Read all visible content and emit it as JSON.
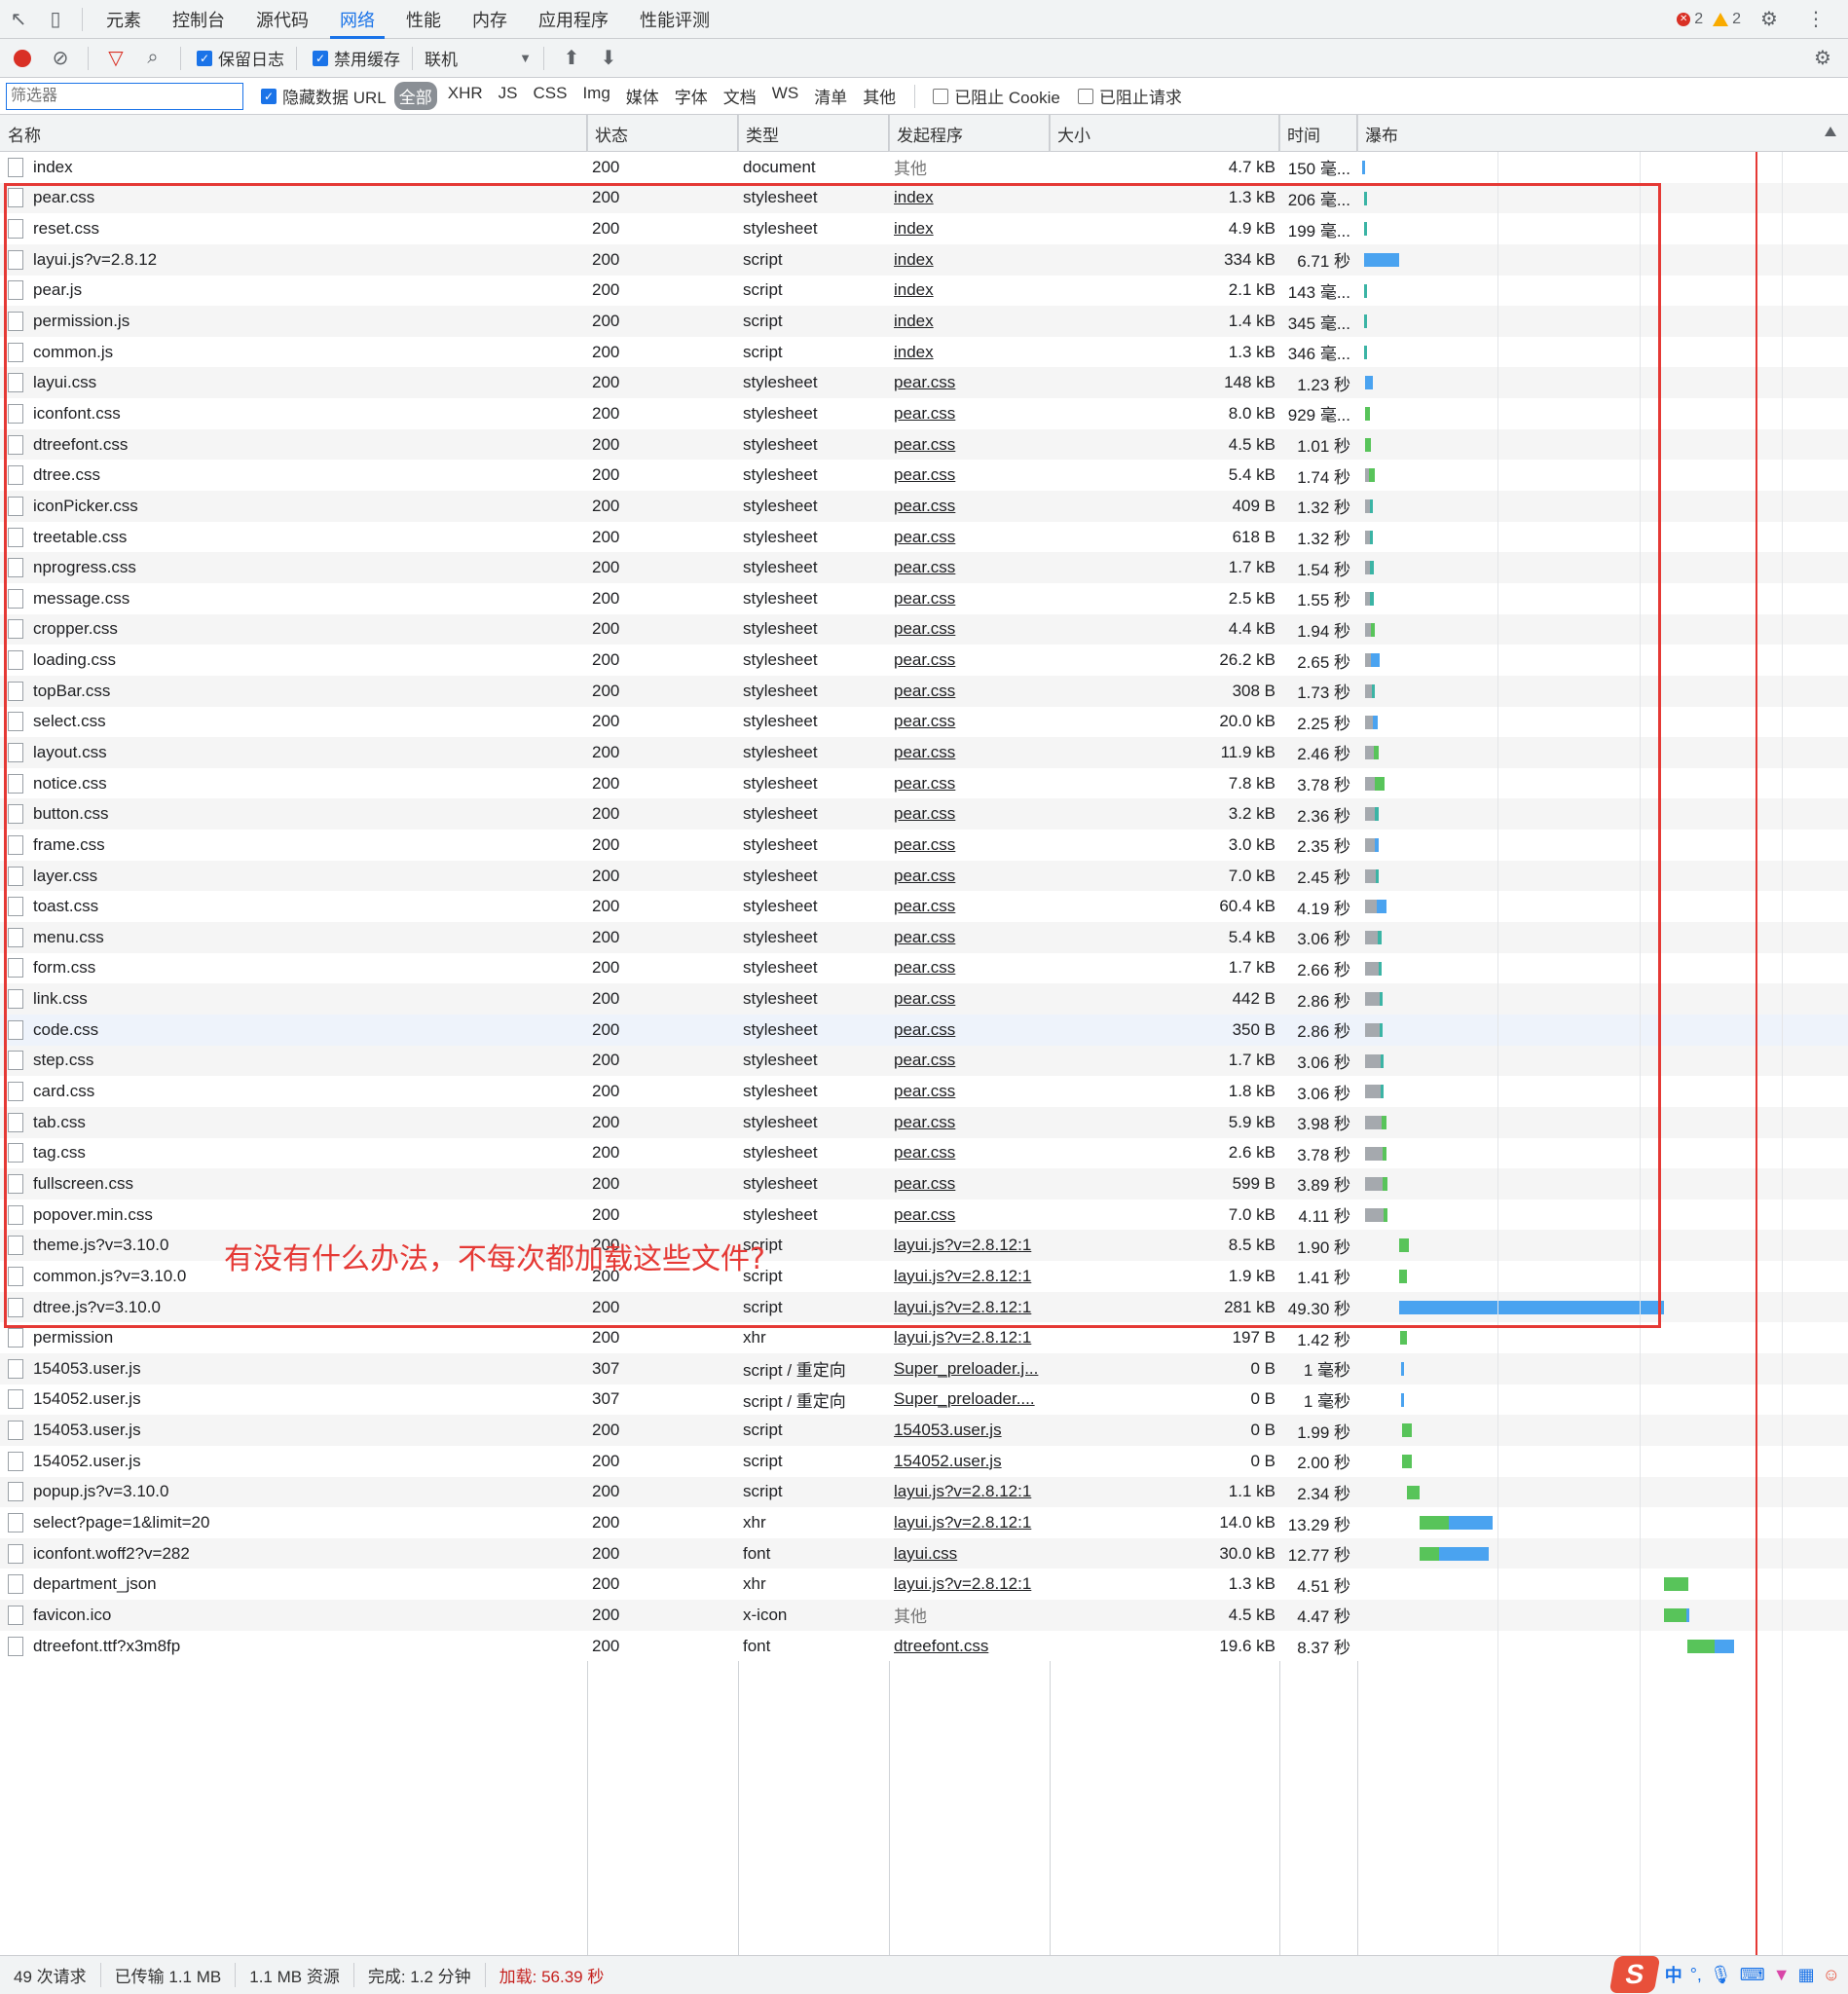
{
  "tabs": [
    "元素",
    "控制台",
    "源代码",
    "网络",
    "性能",
    "内存",
    "应用程序",
    "性能评测"
  ],
  "active_tab": 3,
  "issues": {
    "errors": "2",
    "warnings": "2"
  },
  "toolbar": {
    "preserve_log": "保留日志",
    "disable_cache": "禁用缓存",
    "throttle": "联机"
  },
  "filterbar": {
    "placeholder": "筛选器",
    "hide_data_url": "隐藏数据 URL",
    "types": [
      "全部",
      "XHR",
      "JS",
      "CSS",
      "Img",
      "媒体",
      "字体",
      "文档",
      "WS",
      "清单",
      "其他"
    ],
    "blocked_cookies": "已阻止 Cookie",
    "blocked_requests": "已阻止请求"
  },
  "columns": {
    "name": "名称",
    "status": "状态",
    "type": "类型",
    "initiator": "发起程序",
    "size": "大小",
    "time": "时间",
    "waterfall": "瀑布"
  },
  "colors": {
    "blue": "#4aa3f0",
    "green": "#58c45a",
    "gray": "#a5a9ae",
    "teal": "#3bb4a5",
    "red": "#e53935"
  },
  "rows": [
    {
      "name": "index",
      "status": "200",
      "type": "document",
      "initiator": "其他",
      "init_link": false,
      "size": "4.7 kB",
      "time": "150 毫...",
      "bars": [
        [
          0.008,
          0.004,
          "blue"
        ]
      ]
    },
    {
      "name": "pear.css",
      "status": "200",
      "type": "stylesheet",
      "initiator": "index",
      "init_link": true,
      "size": "1.3 kB",
      "time": "206 毫...",
      "bars": [
        [
          0.012,
          0.004,
          "teal"
        ]
      ]
    },
    {
      "name": "reset.css",
      "status": "200",
      "type": "stylesheet",
      "initiator": "index",
      "init_link": true,
      "size": "4.9 kB",
      "time": "199 毫...",
      "bars": [
        [
          0.012,
          0.004,
          "teal"
        ]
      ]
    },
    {
      "name": "layui.js?v=2.8.12",
      "status": "200",
      "type": "script",
      "initiator": "index",
      "init_link": true,
      "size": "334 kB",
      "time": "6.71 秒",
      "bars": [
        [
          0.012,
          0.072,
          "blue"
        ]
      ]
    },
    {
      "name": "pear.js",
      "status": "200",
      "type": "script",
      "initiator": "index",
      "init_link": true,
      "size": "2.1 kB",
      "time": "143 毫...",
      "bars": [
        [
          0.012,
          0.004,
          "teal"
        ]
      ]
    },
    {
      "name": "permission.js",
      "status": "200",
      "type": "script",
      "initiator": "index",
      "init_link": true,
      "size": "1.4 kB",
      "time": "345 毫...",
      "bars": [
        [
          0.012,
          0.004,
          "teal"
        ]
      ]
    },
    {
      "name": "common.js",
      "status": "200",
      "type": "script",
      "initiator": "index",
      "init_link": true,
      "size": "1.3 kB",
      "time": "346 毫...",
      "bars": [
        [
          0.012,
          0.004,
          "teal"
        ]
      ]
    },
    {
      "name": "layui.css",
      "status": "200",
      "type": "stylesheet",
      "initiator": "pear.css",
      "init_link": true,
      "size": "148 kB",
      "time": "1.23 秒",
      "bars": [
        [
          0.014,
          0.016,
          "blue"
        ]
      ]
    },
    {
      "name": "iconfont.css",
      "status": "200",
      "type": "stylesheet",
      "initiator": "pear.css",
      "init_link": true,
      "size": "8.0 kB",
      "time": "929 毫...",
      "bars": [
        [
          0.014,
          0.01,
          "green"
        ]
      ]
    },
    {
      "name": "dtreefont.css",
      "status": "200",
      "type": "stylesheet",
      "initiator": "pear.css",
      "init_link": true,
      "size": "4.5 kB",
      "time": "1.01 秒",
      "bars": [
        [
          0.014,
          0.012,
          "green"
        ]
      ]
    },
    {
      "name": "dtree.css",
      "status": "200",
      "type": "stylesheet",
      "initiator": "pear.css",
      "init_link": true,
      "size": "5.4 kB",
      "time": "1.74 秒",
      "bars": [
        [
          0.014,
          0.008,
          "gray"
        ],
        [
          0.022,
          0.012,
          "green"
        ]
      ]
    },
    {
      "name": "iconPicker.css",
      "status": "200",
      "type": "stylesheet",
      "initiator": "pear.css",
      "init_link": true,
      "size": "409 B",
      "time": "1.32 秒",
      "bars": [
        [
          0.014,
          0.01,
          "gray"
        ],
        [
          0.024,
          0.006,
          "teal"
        ]
      ]
    },
    {
      "name": "treetable.css",
      "status": "200",
      "type": "stylesheet",
      "initiator": "pear.css",
      "init_link": true,
      "size": "618 B",
      "time": "1.32 秒",
      "bars": [
        [
          0.014,
          0.01,
          "gray"
        ],
        [
          0.024,
          0.006,
          "teal"
        ]
      ]
    },
    {
      "name": "nprogress.css",
      "status": "200",
      "type": "stylesheet",
      "initiator": "pear.css",
      "init_link": true,
      "size": "1.7 kB",
      "time": "1.54 秒",
      "bars": [
        [
          0.014,
          0.01,
          "gray"
        ],
        [
          0.024,
          0.008,
          "teal"
        ]
      ]
    },
    {
      "name": "message.css",
      "status": "200",
      "type": "stylesheet",
      "initiator": "pear.css",
      "init_link": true,
      "size": "2.5 kB",
      "time": "1.55 秒",
      "bars": [
        [
          0.014,
          0.01,
          "gray"
        ],
        [
          0.024,
          0.008,
          "teal"
        ]
      ]
    },
    {
      "name": "cropper.css",
      "status": "200",
      "type": "stylesheet",
      "initiator": "pear.css",
      "init_link": true,
      "size": "4.4 kB",
      "time": "1.94 秒",
      "bars": [
        [
          0.014,
          0.012,
          "gray"
        ],
        [
          0.026,
          0.008,
          "green"
        ]
      ]
    },
    {
      "name": "loading.css",
      "status": "200",
      "type": "stylesheet",
      "initiator": "pear.css",
      "init_link": true,
      "size": "26.2 kB",
      "time": "2.65 秒",
      "bars": [
        [
          0.014,
          0.012,
          "gray"
        ],
        [
          0.026,
          0.018,
          "blue"
        ]
      ]
    },
    {
      "name": "topBar.css",
      "status": "200",
      "type": "stylesheet",
      "initiator": "pear.css",
      "init_link": true,
      "size": "308 B",
      "time": "1.73 秒",
      "bars": [
        [
          0.014,
          0.014,
          "gray"
        ],
        [
          0.028,
          0.006,
          "teal"
        ]
      ]
    },
    {
      "name": "select.css",
      "status": "200",
      "type": "stylesheet",
      "initiator": "pear.css",
      "init_link": true,
      "size": "20.0 kB",
      "time": "2.25 秒",
      "bars": [
        [
          0.014,
          0.016,
          "gray"
        ],
        [
          0.03,
          0.01,
          "blue"
        ]
      ]
    },
    {
      "name": "layout.css",
      "status": "200",
      "type": "stylesheet",
      "initiator": "pear.css",
      "init_link": true,
      "size": "11.9 kB",
      "time": "2.46 秒",
      "bars": [
        [
          0.014,
          0.018,
          "gray"
        ],
        [
          0.032,
          0.01,
          "green"
        ]
      ]
    },
    {
      "name": "notice.css",
      "status": "200",
      "type": "stylesheet",
      "initiator": "pear.css",
      "init_link": true,
      "size": "7.8 kB",
      "time": "3.78 秒",
      "bars": [
        [
          0.014,
          0.02,
          "gray"
        ],
        [
          0.034,
          0.02,
          "green"
        ]
      ]
    },
    {
      "name": "button.css",
      "status": "200",
      "type": "stylesheet",
      "initiator": "pear.css",
      "init_link": true,
      "size": "3.2 kB",
      "time": "2.36 秒",
      "bars": [
        [
          0.014,
          0.02,
          "gray"
        ],
        [
          0.034,
          0.008,
          "teal"
        ]
      ]
    },
    {
      "name": "frame.css",
      "status": "200",
      "type": "stylesheet",
      "initiator": "pear.css",
      "init_link": true,
      "size": "3.0 kB",
      "time": "2.35 秒",
      "bars": [
        [
          0.014,
          0.02,
          "gray"
        ],
        [
          0.034,
          0.008,
          "blue"
        ]
      ]
    },
    {
      "name": "layer.css",
      "status": "200",
      "type": "stylesheet",
      "initiator": "pear.css",
      "init_link": true,
      "size": "7.0 kB",
      "time": "2.45 秒",
      "bars": [
        [
          0.014,
          0.022,
          "gray"
        ],
        [
          0.036,
          0.006,
          "teal"
        ]
      ]
    },
    {
      "name": "toast.css",
      "status": "200",
      "type": "stylesheet",
      "initiator": "pear.css",
      "init_link": true,
      "size": "60.4 kB",
      "time": "4.19 秒",
      "bars": [
        [
          0.014,
          0.024,
          "gray"
        ],
        [
          0.038,
          0.02,
          "blue"
        ]
      ]
    },
    {
      "name": "menu.css",
      "status": "200",
      "type": "stylesheet",
      "initiator": "pear.css",
      "init_link": true,
      "size": "5.4 kB",
      "time": "3.06 秒",
      "bars": [
        [
          0.014,
          0.026,
          "gray"
        ],
        [
          0.04,
          0.008,
          "teal"
        ]
      ]
    },
    {
      "name": "form.css",
      "status": "200",
      "type": "stylesheet",
      "initiator": "pear.css",
      "init_link": true,
      "size": "1.7 kB",
      "time": "2.66 秒",
      "bars": [
        [
          0.014,
          0.028,
          "gray"
        ],
        [
          0.042,
          0.006,
          "teal"
        ]
      ]
    },
    {
      "name": "link.css",
      "status": "200",
      "type": "stylesheet",
      "initiator": "pear.css",
      "init_link": true,
      "size": "442 B",
      "time": "2.86 秒",
      "bars": [
        [
          0.014,
          0.03,
          "gray"
        ],
        [
          0.044,
          0.006,
          "teal"
        ]
      ]
    },
    {
      "name": "code.css",
      "status": "200",
      "type": "stylesheet",
      "initiator": "pear.css",
      "init_link": true,
      "size": "350 B",
      "time": "2.86 秒",
      "bars": [
        [
          0.014,
          0.03,
          "gray"
        ],
        [
          0.044,
          0.006,
          "teal"
        ]
      ],
      "hl": true
    },
    {
      "name": "step.css",
      "status": "200",
      "type": "stylesheet",
      "initiator": "pear.css",
      "init_link": true,
      "size": "1.7 kB",
      "time": "3.06 秒",
      "bars": [
        [
          0.014,
          0.032,
          "gray"
        ],
        [
          0.046,
          0.006,
          "teal"
        ]
      ]
    },
    {
      "name": "card.css",
      "status": "200",
      "type": "stylesheet",
      "initiator": "pear.css",
      "init_link": true,
      "size": "1.8 kB",
      "time": "3.06 秒",
      "bars": [
        [
          0.014,
          0.032,
          "gray"
        ],
        [
          0.046,
          0.006,
          "teal"
        ]
      ]
    },
    {
      "name": "tab.css",
      "status": "200",
      "type": "stylesheet",
      "initiator": "pear.css",
      "init_link": true,
      "size": "5.9 kB",
      "time": "3.98 秒",
      "bars": [
        [
          0.014,
          0.034,
          "gray"
        ],
        [
          0.048,
          0.01,
          "green"
        ]
      ]
    },
    {
      "name": "tag.css",
      "status": "200",
      "type": "stylesheet",
      "initiator": "pear.css",
      "init_link": true,
      "size": "2.6 kB",
      "time": "3.78 秒",
      "bars": [
        [
          0.014,
          0.036,
          "gray"
        ],
        [
          0.05,
          0.008,
          "green"
        ]
      ]
    },
    {
      "name": "fullscreen.css",
      "status": "200",
      "type": "stylesheet",
      "initiator": "pear.css",
      "init_link": true,
      "size": "599 B",
      "time": "3.89 秒",
      "bars": [
        [
          0.014,
          0.036,
          "gray"
        ],
        [
          0.05,
          0.01,
          "green"
        ]
      ]
    },
    {
      "name": "popover.min.css",
      "status": "200",
      "type": "stylesheet",
      "initiator": "pear.css",
      "init_link": true,
      "size": "7.0 kB",
      "time": "4.11 秒",
      "bars": [
        [
          0.014,
          0.038,
          "gray"
        ],
        [
          0.052,
          0.008,
          "green"
        ]
      ]
    },
    {
      "name": "theme.js?v=3.10.0",
      "status": "200",
      "type": "script",
      "initiator": "layui.js?v=2.8.12:1",
      "init_link": true,
      "size": "8.5 kB",
      "time": "1.90 秒",
      "bars": [
        [
          0.084,
          0.02,
          "green"
        ]
      ]
    },
    {
      "name": "common.js?v=3.10.0",
      "status": "200",
      "type": "script",
      "initiator": "layui.js?v=2.8.12:1",
      "init_link": true,
      "size": "1.9 kB",
      "time": "1.41 秒",
      "bars": [
        [
          0.084,
          0.016,
          "green"
        ]
      ]
    },
    {
      "name": "dtree.js?v=3.10.0",
      "status": "200",
      "type": "script",
      "initiator": "layui.js?v=2.8.12:1",
      "init_link": true,
      "size": "281 kB",
      "time": "49.30 秒",
      "bars": [
        [
          0.084,
          0.54,
          "blue"
        ]
      ]
    },
    {
      "name": "permission",
      "status": "200",
      "type": "xhr",
      "initiator": "layui.js?v=2.8.12:1",
      "init_link": true,
      "size": "197 B",
      "time": "1.42 秒",
      "bars": [
        [
          0.086,
          0.014,
          "green"
        ]
      ]
    },
    {
      "name": "154053.user.js",
      "status": "307",
      "type": "script / 重定向",
      "initiator": "Super_preloader.j...",
      "init_link": true,
      "size": "0 B",
      "time": "1 毫秒",
      "bars": [
        [
          0.088,
          0.004,
          "blue"
        ]
      ]
    },
    {
      "name": "154052.user.js",
      "status": "307",
      "type": "script / 重定向",
      "initiator": "Super_preloader....",
      "init_link": true,
      "size": "0 B",
      "time": "1 毫秒",
      "bars": [
        [
          0.088,
          0.004,
          "blue"
        ]
      ]
    },
    {
      "name": "154053.user.js",
      "status": "200",
      "type": "script",
      "initiator": "154053.user.js",
      "init_link": true,
      "size": "0 B",
      "time": "1.99 秒",
      "bars": [
        [
          0.09,
          0.02,
          "green"
        ]
      ]
    },
    {
      "name": "154052.user.js",
      "status": "200",
      "type": "script",
      "initiator": "154052.user.js",
      "init_link": true,
      "size": "0 B",
      "time": "2.00 秒",
      "bars": [
        [
          0.09,
          0.02,
          "green"
        ]
      ]
    },
    {
      "name": "popup.js?v=3.10.0",
      "status": "200",
      "type": "script",
      "initiator": "layui.js?v=2.8.12:1",
      "init_link": true,
      "size": "1.1 kB",
      "time": "2.34 秒",
      "bars": [
        [
          0.1,
          0.026,
          "green"
        ]
      ]
    },
    {
      "name": "select?page=1&limit=20",
      "status": "200",
      "type": "xhr",
      "initiator": "layui.js?v=2.8.12:1",
      "init_link": true,
      "size": "14.0 kB",
      "time": "13.29 秒",
      "bars": [
        [
          0.126,
          0.058,
          "green"
        ],
        [
          0.184,
          0.09,
          "blue"
        ]
      ]
    },
    {
      "name": "iconfont.woff2?v=282",
      "status": "200",
      "type": "font",
      "initiator": "layui.css",
      "init_link": true,
      "size": "30.0 kB",
      "time": "12.77 秒",
      "bars": [
        [
          0.126,
          0.04,
          "green"
        ],
        [
          0.166,
          0.1,
          "blue"
        ]
      ]
    },
    {
      "name": "department_json",
      "status": "200",
      "type": "xhr",
      "initiator": "layui.js?v=2.8.12:1",
      "init_link": true,
      "size": "1.3 kB",
      "time": "4.51 秒",
      "bars": [
        [
          0.624,
          0.05,
          "green"
        ]
      ]
    },
    {
      "name": "favicon.ico",
      "status": "200",
      "type": "x-icon",
      "initiator": "其他",
      "init_link": false,
      "size": "4.5 kB",
      "time": "4.47 秒",
      "bars": [
        [
          0.624,
          0.046,
          "green"
        ],
        [
          0.67,
          0.006,
          "blue"
        ]
      ]
    },
    {
      "name": "dtreefont.ttf?x3m8fp",
      "status": "200",
      "type": "font",
      "initiator": "dtreefont.css",
      "init_link": true,
      "size": "19.6 kB",
      "time": "8.37 秒",
      "bars": [
        [
          0.672,
          0.056,
          "green"
        ],
        [
          0.728,
          0.04,
          "blue"
        ]
      ]
    }
  ],
  "annotation": "有没有什么办法，不每次都加载这些文件?",
  "statusbar": {
    "requests": "49 次请求",
    "transferred": "已传输 1.1 MB",
    "resources": "1.1 MB 资源",
    "finish": "完成: 1.2 分钟",
    "load": "加载: 56.39 秒"
  },
  "ime": {
    "lang": "中"
  }
}
